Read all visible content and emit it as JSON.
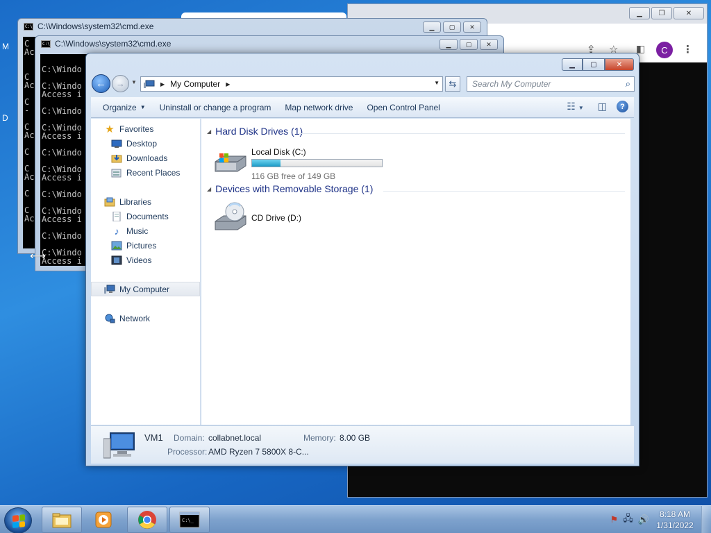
{
  "desktop": {
    "left_letters": [
      "M",
      "D"
    ]
  },
  "chrome": {
    "profile_initial": "C"
  },
  "cmd_windows": [
    {
      "title": "C:\\Windows\\system32\\cmd.exe",
      "lines": [
        "C",
        "Ac",
        "",
        "",
        "C",
        "Ac",
        "",
        "C",
        "-",
        "",
        "C",
        "Ac",
        "",
        "C",
        "",
        "C",
        "Ac",
        "",
        "C",
        "",
        "C",
        "Ac"
      ]
    },
    {
      "title": "C:\\Windows\\system32\\cmd.exe",
      "lines": [
        "",
        "C:\\Windo",
        "",
        "C:\\Windo",
        "Access i",
        "",
        "C:\\Windo",
        "",
        "C:\\Windo",
        "Access i",
        "",
        "C:\\Windo",
        "",
        "C:\\Windo",
        "Access i",
        "",
        "C:\\Windo",
        "",
        "C:\\Windo",
        "Access i",
        "",
        "C:\\Windo",
        "",
        "C:\\Windo",
        "Access i",
        "",
        "C:\\Windo"
      ]
    }
  ],
  "explorer": {
    "breadcrumb": "My Computer",
    "search_placeholder": "Search My Computer",
    "commands": [
      "Organize",
      "Uninstall or change a program",
      "Map network drive",
      "Open Control Panel"
    ],
    "nav": {
      "favorites": "Favorites",
      "desktop": "Desktop",
      "downloads": "Downloads",
      "recent_places": "Recent Places",
      "libraries": "Libraries",
      "documents": "Documents",
      "music": "Music",
      "pictures": "Pictures",
      "videos": "Videos",
      "my_computer": "My Computer",
      "network": "Network"
    },
    "groups": {
      "hdd": "Hard Disk Drives (1)",
      "removable": "Devices with Removable Storage (1)"
    },
    "drives": {
      "c_name": "Local Disk (C:)",
      "c_free": "116 GB free of 149 GB",
      "c_used_fraction": 0.22,
      "d_name": "CD Drive (D:)"
    },
    "details": {
      "name": "VM1",
      "domain_label": "Domain:",
      "domain_value": "collabnet.local",
      "memory_label": "Memory:",
      "memory_value": "8.00 GB",
      "processor_label": "Processor:",
      "processor_value": "AMD Ryzen 7 5800X 8-C..."
    }
  },
  "taskbar": {
    "time": "8:18 AM",
    "date": "1/31/2022"
  },
  "colors": {
    "explorer_frame": "#c2d6ee",
    "selected_nav": "#e3e8ef",
    "drive_fill": "#1a9ac6",
    "taskbar": "#7ea2cd"
  }
}
